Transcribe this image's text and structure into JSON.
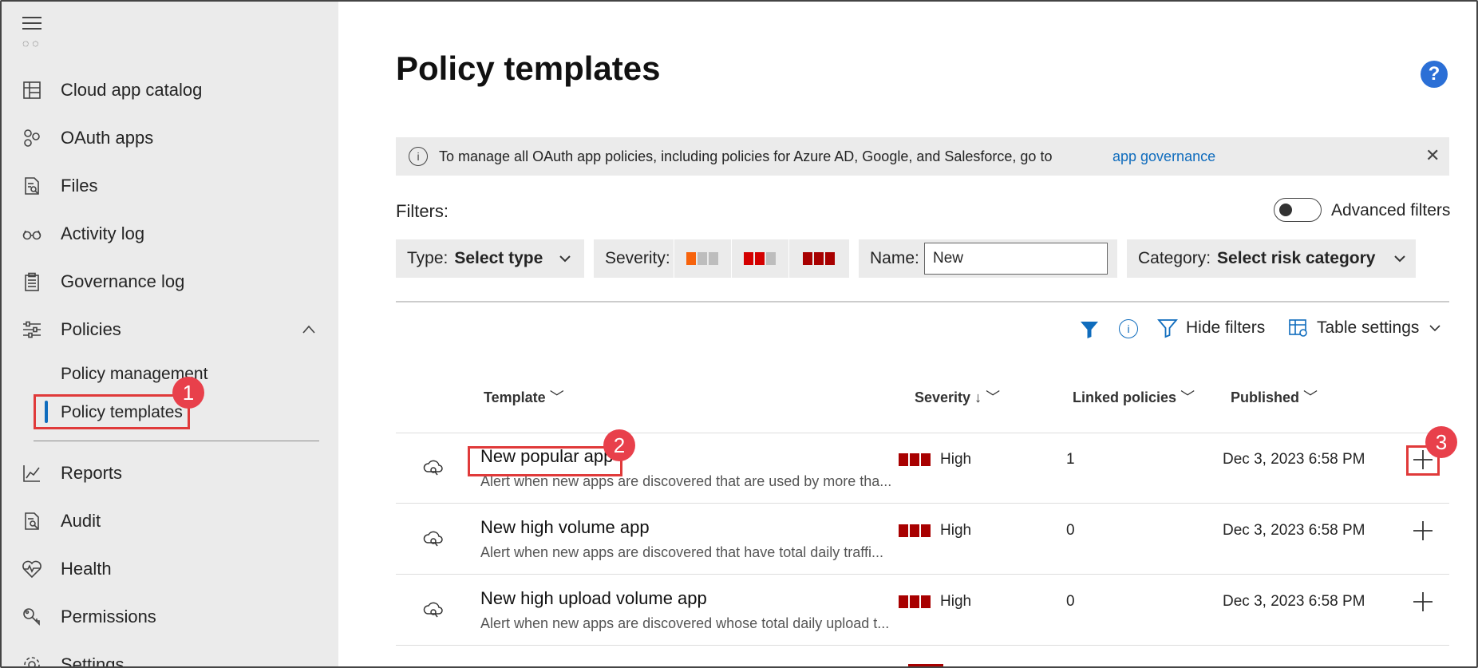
{
  "sidebar": {
    "items": [
      {
        "label": "Cloud app catalog",
        "icon": "catalog-icon"
      },
      {
        "label": "OAuth apps",
        "icon": "oauth-icon"
      },
      {
        "label": "Files",
        "icon": "file-search-icon"
      },
      {
        "label": "Activity log",
        "icon": "glasses-icon"
      },
      {
        "label": "Governance log",
        "icon": "clipboard-icon"
      },
      {
        "label": "Policies",
        "icon": "sliders-icon"
      }
    ],
    "sub_items": [
      {
        "label": "Policy management"
      },
      {
        "label": "Policy templates"
      }
    ],
    "bottom_items": [
      {
        "label": "Reports",
        "icon": "chart-line-icon"
      },
      {
        "label": "Audit",
        "icon": "audit-icon"
      },
      {
        "label": "Health",
        "icon": "heart-icon"
      },
      {
        "label": "Permissions",
        "icon": "key-icon"
      },
      {
        "label": "Settings",
        "icon": "gear-icon"
      }
    ]
  },
  "annotations": {
    "b1": "1",
    "b2": "2",
    "b3": "3"
  },
  "header": {
    "title": "Policy templates",
    "help": "?"
  },
  "info_bar": {
    "message": "To manage all OAuth app policies, including policies for Azure AD, Google, and Salesforce, go to",
    "link": "app governance"
  },
  "filters": {
    "label": "Filters:",
    "advanced_label": "Advanced filters",
    "type_key": "Type:",
    "type_value": "Select type",
    "severity_key": "Severity:",
    "name_key": "Name:",
    "name_value": "New",
    "category_key": "Category:",
    "category_value": "Select risk category"
  },
  "toolbar": {
    "hide_filters": "Hide filters",
    "table_settings": "Table settings"
  },
  "table": {
    "columns": [
      "Template",
      "Severity",
      "Linked policies",
      "Published"
    ],
    "rows": [
      {
        "title": "New popular app",
        "desc": "Alert when new apps are discovered that are used by more tha...",
        "severity": "High",
        "linked": "1",
        "published": "Dec 3, 2023 6:58 PM"
      },
      {
        "title": "New high volume app",
        "desc": "Alert when new apps are discovered that have total daily traffi...",
        "severity": "High",
        "linked": "0",
        "published": "Dec 3, 2023 6:58 PM"
      },
      {
        "title": "New high upload volume app",
        "desc": "Alert when new apps are discovered whose total daily upload t...",
        "severity": "High",
        "linked": "0",
        "published": "Dec 3, 2023 6:58 PM"
      }
    ]
  },
  "colors": {
    "accent": "#0f6cbd",
    "high": "#a80000",
    "annotation": "#e03a3a",
    "sidebar_bg": "#ebebeb"
  }
}
